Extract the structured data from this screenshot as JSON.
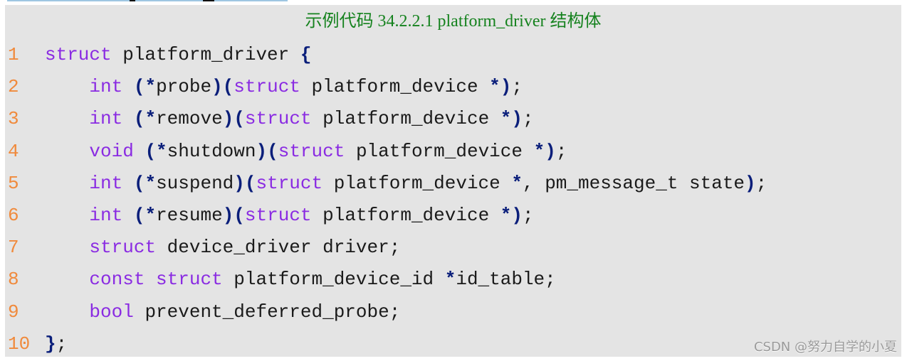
{
  "caption": "示例代码 34.2.2.1 platform_driver 结构体",
  "code": {
    "language": "c",
    "lines": [
      {
        "num": "1",
        "tokens": [
          [
            "kw",
            "struct"
          ],
          [
            "tx",
            " platform_driver "
          ],
          [
            "pn",
            "{"
          ]
        ]
      },
      {
        "num": "2",
        "tokens": [
          [
            "tx",
            "    "
          ],
          [
            "kw",
            "int"
          ],
          [
            "tx",
            " "
          ],
          [
            "pn",
            "(*"
          ],
          [
            "tx",
            "probe"
          ],
          [
            "pn",
            ")("
          ],
          [
            "kw",
            "struct"
          ],
          [
            "tx",
            " platform_device "
          ],
          [
            "pn",
            "*)"
          ],
          [
            "tx",
            ";"
          ]
        ]
      },
      {
        "num": "3",
        "tokens": [
          [
            "tx",
            "    "
          ],
          [
            "kw",
            "int"
          ],
          [
            "tx",
            " "
          ],
          [
            "pn",
            "(*"
          ],
          [
            "tx",
            "remove"
          ],
          [
            "pn",
            ")("
          ],
          [
            "kw",
            "struct"
          ],
          [
            "tx",
            " platform_device "
          ],
          [
            "pn",
            "*)"
          ],
          [
            "tx",
            ";"
          ]
        ]
      },
      {
        "num": "4",
        "tokens": [
          [
            "tx",
            "    "
          ],
          [
            "kw",
            "void"
          ],
          [
            "tx",
            " "
          ],
          [
            "pn",
            "(*"
          ],
          [
            "tx",
            "shutdown"
          ],
          [
            "pn",
            ")("
          ],
          [
            "kw",
            "struct"
          ],
          [
            "tx",
            " platform_device "
          ],
          [
            "pn",
            "*)"
          ],
          [
            "tx",
            ";"
          ]
        ]
      },
      {
        "num": "5",
        "tokens": [
          [
            "tx",
            "    "
          ],
          [
            "kw",
            "int"
          ],
          [
            "tx",
            " "
          ],
          [
            "pn",
            "(*"
          ],
          [
            "tx",
            "suspend"
          ],
          [
            "pn",
            ")("
          ],
          [
            "kw",
            "struct"
          ],
          [
            "tx",
            " platform_device "
          ],
          [
            "pn",
            "*"
          ],
          [
            "tx",
            ", pm_message_t state"
          ],
          [
            "pn",
            ")"
          ],
          [
            "tx",
            ";"
          ]
        ]
      },
      {
        "num": "6",
        "tokens": [
          [
            "tx",
            "    "
          ],
          [
            "kw",
            "int"
          ],
          [
            "tx",
            " "
          ],
          [
            "pn",
            "(*"
          ],
          [
            "tx",
            "resume"
          ],
          [
            "pn",
            ")("
          ],
          [
            "kw",
            "struct"
          ],
          [
            "tx",
            " platform_device "
          ],
          [
            "pn",
            "*)"
          ],
          [
            "tx",
            ";"
          ]
        ]
      },
      {
        "num": "7",
        "tokens": [
          [
            "tx",
            "    "
          ],
          [
            "kw",
            "struct"
          ],
          [
            "tx",
            " device_driver driver;"
          ]
        ]
      },
      {
        "num": "8",
        "tokens": [
          [
            "tx",
            "    "
          ],
          [
            "kw",
            "const"
          ],
          [
            "tx",
            " "
          ],
          [
            "kw",
            "struct"
          ],
          [
            "tx",
            " platform_device_id "
          ],
          [
            "pn",
            "*"
          ],
          [
            "tx",
            "id_table;"
          ]
        ]
      },
      {
        "num": "9",
        "tokens": [
          [
            "tx",
            "    "
          ],
          [
            "kw",
            "bool"
          ],
          [
            "tx",
            " prevent_deferred_probe;"
          ]
        ]
      },
      {
        "num": "10",
        "tokens": [
          [
            "pn",
            "}"
          ],
          [
            "tx",
            ";"
          ]
        ]
      }
    ]
  },
  "watermark": "CSDN @努力自学的小夏",
  "colors": {
    "panel_bg": "#e4e4e4",
    "caption": "#15821e",
    "line_number": "#f08a3c",
    "keyword": "#8a2be2",
    "punctuation": "#0a1e7a",
    "text": "#1a1a1a"
  }
}
